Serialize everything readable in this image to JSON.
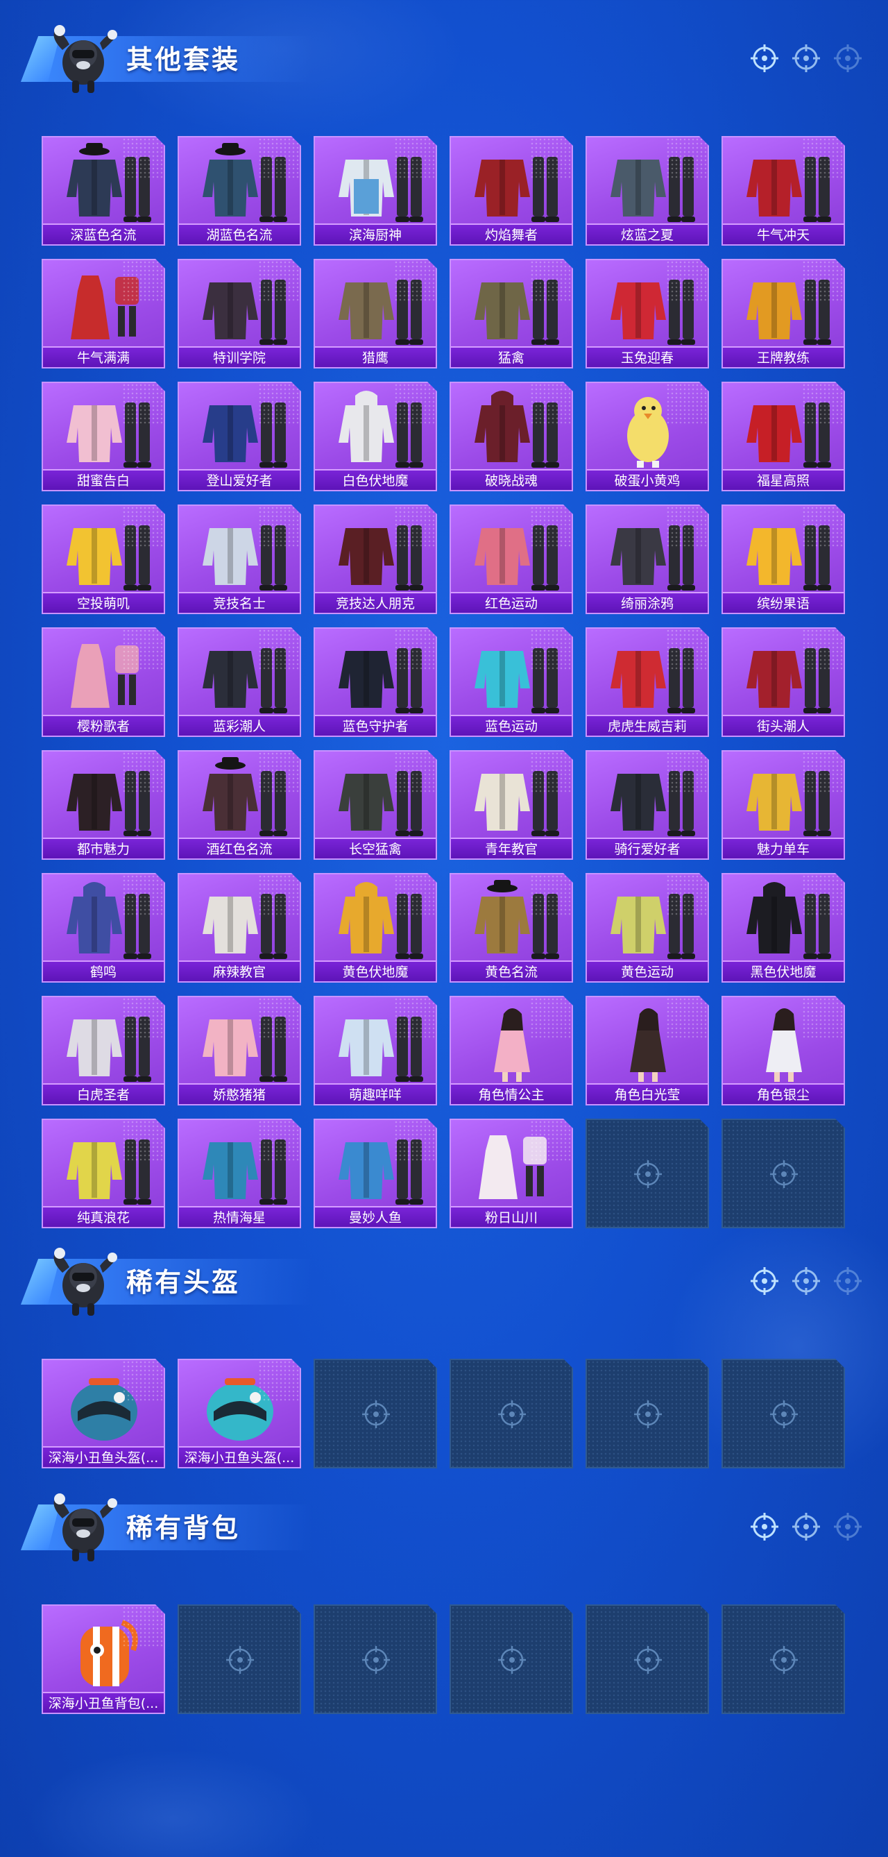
{
  "sections": [
    {
      "title": "其他套装",
      "items": [
        {
          "label": "深蓝色名流",
          "icon": "suit-outfit-icon",
          "color": "#2d3a55"
        },
        {
          "label": "湖蓝色名流",
          "icon": "suit-outfit-icon",
          "color": "#2f5170"
        },
        {
          "label": "滨海厨神",
          "icon": "chef-outfit-icon",
          "color": "#dfe8f0"
        },
        {
          "label": "灼焰舞者",
          "icon": "coat-outfit-icon",
          "color": "#9a2126"
        },
        {
          "label": "炫蓝之夏",
          "icon": "outfit-icon",
          "color": "#4a5a6a"
        },
        {
          "label": "牛气冲天",
          "icon": "outfit-icon",
          "color": "#b52029"
        },
        {
          "label": "牛气满满",
          "icon": "dress-outfit-icon",
          "color": "#c72c2c"
        },
        {
          "label": "特训学院",
          "icon": "uniform-outfit-icon",
          "color": "#3b2f3f"
        },
        {
          "label": "猎鹰",
          "icon": "jacket-outfit-icon",
          "color": "#7a6a4e"
        },
        {
          "label": "猛禽",
          "icon": "jacket-outfit-icon",
          "color": "#6f6647"
        },
        {
          "label": "玉兔迎春",
          "icon": "outfit-icon",
          "color": "#cf2834"
        },
        {
          "label": "王牌教练",
          "icon": "outfit-icon",
          "color": "#e29a22"
        },
        {
          "label": "甜蜜告白",
          "icon": "jacket-outfit-icon",
          "color": "#f1bfd1"
        },
        {
          "label": "登山爱好者",
          "icon": "jacket-outfit-icon",
          "color": "#273d8a"
        },
        {
          "label": "白色伏地魔",
          "icon": "hoodie-outfit-icon",
          "color": "#e8e8ec"
        },
        {
          "label": "破晓战魂",
          "icon": "hoodie-outfit-icon",
          "color": "#6b1f2a"
        },
        {
          "label": "破蛋小黄鸡",
          "icon": "chick-outfit-icon",
          "color": "#f4dd6a"
        },
        {
          "label": "福星高照",
          "icon": "outfit-icon",
          "color": "#c61f26"
        },
        {
          "label": "空投萌叽",
          "icon": "outfit-icon",
          "color": "#f2c331"
        },
        {
          "label": "竞技名士",
          "icon": "jacket-outfit-icon",
          "color": "#cdd6e6"
        },
        {
          "label": "竞技达人朋克",
          "icon": "jacket-outfit-icon",
          "color": "#5a1f24"
        },
        {
          "label": "红色运动",
          "icon": "jacket-outfit-icon",
          "color": "#e06f86"
        },
        {
          "label": "绮丽涂鸦",
          "icon": "jacket-outfit-icon",
          "color": "#3a3944"
        },
        {
          "label": "缤纷果语",
          "icon": "outfit-icon",
          "color": "#f3b72c"
        },
        {
          "label": "樱粉歌者",
          "icon": "dress-outfit-icon",
          "color": "#eaa0b8"
        },
        {
          "label": "蓝彩潮人",
          "icon": "jacket-outfit-icon",
          "color": "#2b2e3a"
        },
        {
          "label": "蓝色守护者",
          "icon": "outfit-icon",
          "color": "#1f2433"
        },
        {
          "label": "蓝色运动",
          "icon": "jacket-outfit-icon",
          "color": "#39c0d8"
        },
        {
          "label": "虎虎生威吉莉",
          "icon": "outfit-icon",
          "color": "#cf2b32"
        },
        {
          "label": "街头潮人",
          "icon": "jacket-outfit-icon",
          "color": "#a3202c"
        },
        {
          "label": "都市魅力",
          "icon": "outfit-icon",
          "color": "#2c2025"
        },
        {
          "label": "酒红色名流",
          "icon": "suit-outfit-icon",
          "color": "#4a2f36"
        },
        {
          "label": "长空猛禽",
          "icon": "jacket-outfit-icon",
          "color": "#3a3f3c"
        },
        {
          "label": "青年教官",
          "icon": "uniform-outfit-icon",
          "color": "#e9e3d6"
        },
        {
          "label": "骑行爱好者",
          "icon": "jacket-outfit-icon",
          "color": "#2a2d38"
        },
        {
          "label": "魅力单车",
          "icon": "outfit-icon",
          "color": "#e7b634"
        },
        {
          "label": "鹤鸣",
          "icon": "hoodie-outfit-icon",
          "color": "#3f4ea3"
        },
        {
          "label": "麻辣教官",
          "icon": "uniform-outfit-icon",
          "color": "#e4e0dc"
        },
        {
          "label": "黄色伏地魔",
          "icon": "hoodie-outfit-icon",
          "color": "#e7a92d"
        },
        {
          "label": "黄色名流",
          "icon": "suit-outfit-icon",
          "color": "#9c7a3e"
        },
        {
          "label": "黄色运动",
          "icon": "jacket-outfit-icon",
          "color": "#cfd06a"
        },
        {
          "label": "黑色伏地魔",
          "icon": "hoodie-outfit-icon",
          "color": "#1c1c22"
        },
        {
          "label": "白虎圣者",
          "icon": "outfit-icon",
          "color": "#dedbe4"
        },
        {
          "label": "娇憨猪猪",
          "icon": "outfit-icon",
          "color": "#f2b3c4"
        },
        {
          "label": "萌趣咩咩",
          "icon": "outfit-icon",
          "color": "#cfe0f2"
        },
        {
          "label": "角色情公主",
          "icon": "character-icon",
          "color": "#f3b0c6"
        },
        {
          "label": "角色白光莹",
          "icon": "character-icon",
          "color": "#3a2a28"
        },
        {
          "label": "角色银尘",
          "icon": "character-icon",
          "color": "#eeeef4"
        },
        {
          "label": "纯真浪花",
          "icon": "outfit-icon",
          "color": "#e1d54a"
        },
        {
          "label": "热情海星",
          "icon": "outfit-icon",
          "color": "#2e88b8"
        },
        {
          "label": "曼妙人鱼",
          "icon": "outfit-icon",
          "color": "#3a8ad0"
        },
        {
          "label": "粉日山川",
          "icon": "dress-outfit-icon",
          "color": "#f3eaf0"
        }
      ],
      "empty_slots": 2
    },
    {
      "title": "稀有头盔",
      "items": [
        {
          "label": "深海小丑鱼头盔(...",
          "icon": "helmet-icon",
          "color": "#2e7fa6"
        },
        {
          "label": "深海小丑鱼头盔(...",
          "icon": "helmet-icon",
          "color": "#34b7c9"
        }
      ],
      "empty_slots": 4
    },
    {
      "title": "稀有背包",
      "items": [
        {
          "label": "深海小丑鱼背包(...",
          "icon": "backpack-icon",
          "color": "#f06a1f"
        }
      ],
      "empty_slots": 5
    }
  ]
}
